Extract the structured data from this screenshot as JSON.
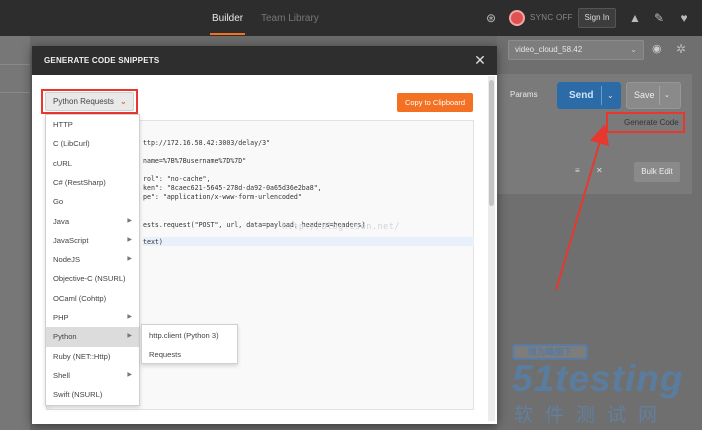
{
  "topbar": {
    "tabs": [
      "Builder",
      "Team Library"
    ],
    "sync_label": "SYNC OFF",
    "signin_label": "Sign In",
    "icons": [
      "satellite-icon",
      "bell-icon",
      "wrench-icon",
      "heart-icon"
    ]
  },
  "environment": {
    "selected": "video_cloud_58.42"
  },
  "request_bar": {
    "params_label": "Params",
    "send_label": "Send",
    "save_label": "Save",
    "generate_code_label": "Generate Code",
    "bulk_edit_label": "Bulk Edit"
  },
  "modal": {
    "title": "GENERATE CODE SNIPPETS",
    "selected_language": "Python Requests",
    "copy_label": "Copy to Clipboard",
    "languages": [
      {
        "label": "HTTP",
        "submenu": false
      },
      {
        "label": "C (LibCurl)",
        "submenu": false
      },
      {
        "label": "cURL",
        "submenu": false
      },
      {
        "label": "C# (RestSharp)",
        "submenu": false
      },
      {
        "label": "Go",
        "submenu": false
      },
      {
        "label": "Java",
        "submenu": true
      },
      {
        "label": "JavaScript",
        "submenu": true
      },
      {
        "label": "NodeJS",
        "submenu": true
      },
      {
        "label": "Objective-C (NSURL)",
        "submenu": false
      },
      {
        "label": "OCaml (Cohttp)",
        "submenu": false
      },
      {
        "label": "PHP",
        "submenu": true
      },
      {
        "label": "Python",
        "submenu": true,
        "active": true
      },
      {
        "label": "Ruby (NET::Http)",
        "submenu": false
      },
      {
        "label": "Shell",
        "submenu": true
      },
      {
        "label": "Swift (NSURL)",
        "submenu": false
      }
    ],
    "python_submenu": [
      "http.client (Python 3)",
      "Requests"
    ],
    "code_lines": [
      "ttp://172.16.58.42:3003/delay/3\"",
      "name=%7B%7Busername%7D%7D\"",
      "rol\": \"no-cache\",",
      "ken\": \"8caec621-5645-278d-da92-0a65d36e2ba8\",",
      "pe\": \"application/x-www-form-urlencoded\"",
      "ests.request(\"POST\", url, data=payload, headers=headers)",
      "text)"
    ]
  },
  "watermark": {
    "faint_text": "http://blog.csdn.net/",
    "box_text": "博为峰旗下",
    "logo_text": "51testing",
    "sub_text": "软件测试网"
  },
  "colors": {
    "accent": "#f47023",
    "send": "#2a6ba8",
    "annotation": "#e8372f"
  }
}
